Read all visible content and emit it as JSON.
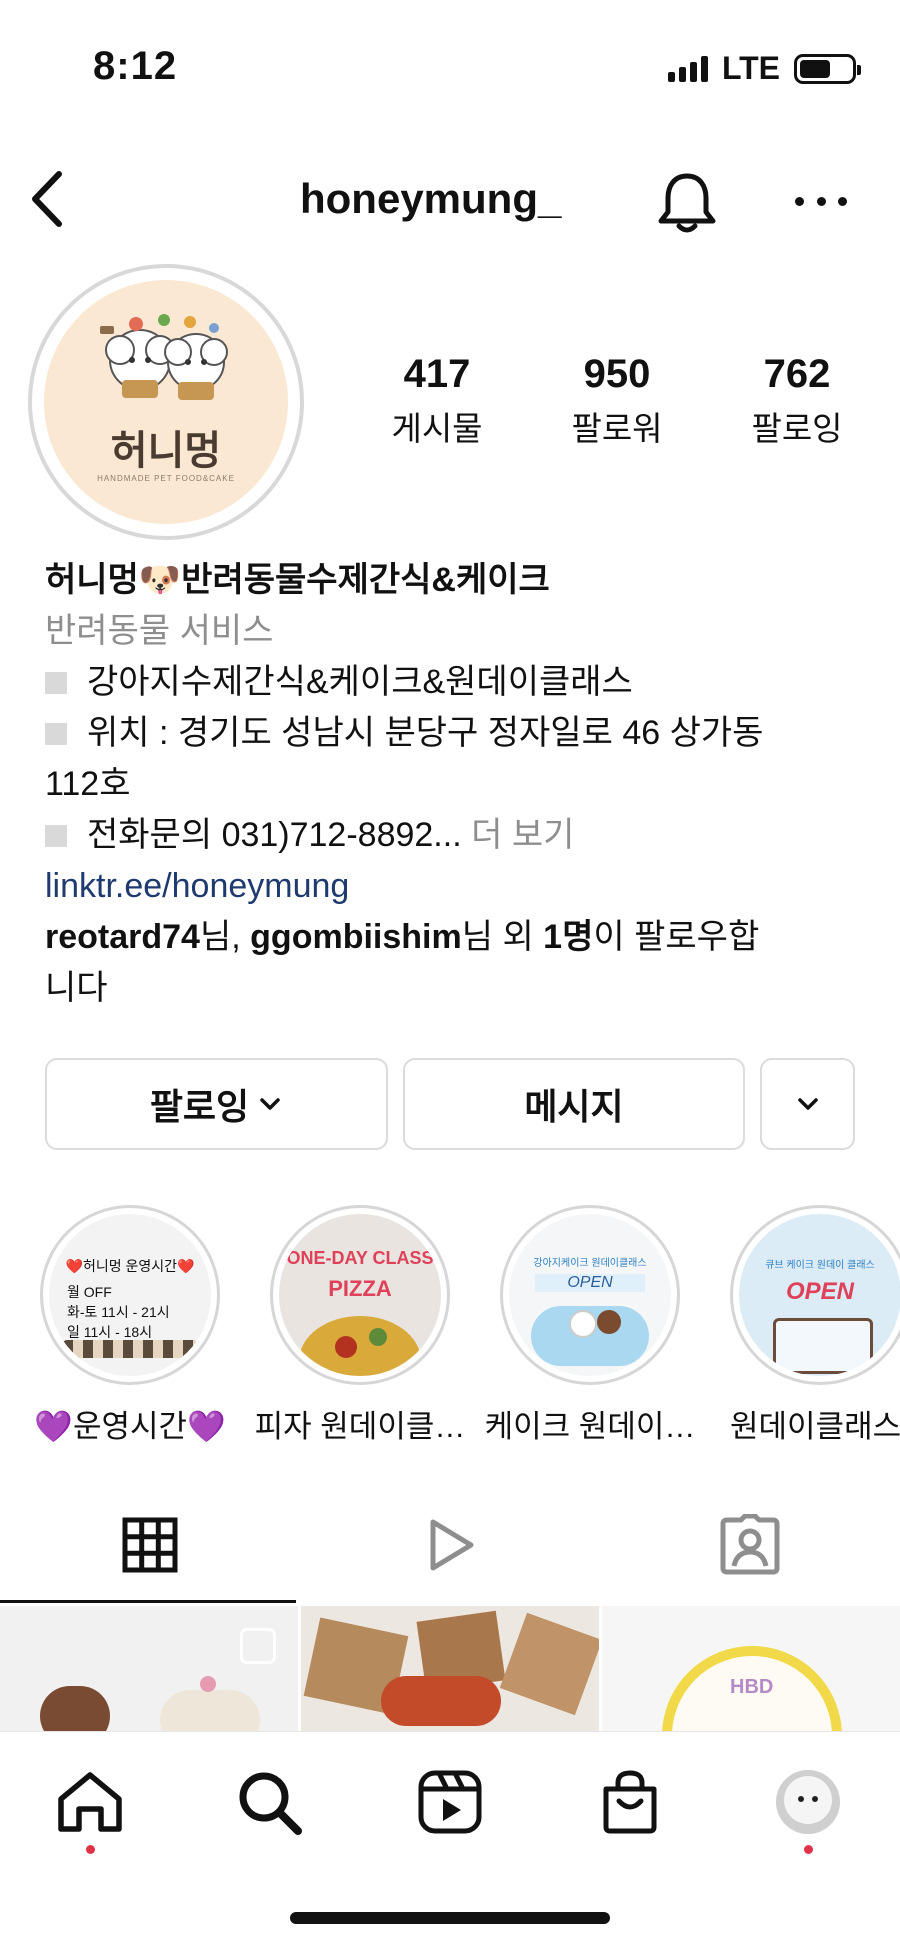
{
  "status_bar": {
    "time": "8:12",
    "network": "LTE"
  },
  "header": {
    "username": "honeymung_"
  },
  "avatar": {
    "logo_text": "허니멍",
    "logo_subtext": "HANDMADE PET FOOD&CAKE"
  },
  "stats": [
    {
      "value": "417",
      "label": "게시물"
    },
    {
      "value": "950",
      "label": "팔로워"
    },
    {
      "value": "762",
      "label": "팔로잉"
    }
  ],
  "bio": {
    "name": "허니멍🐶반려동물수제간식&케이크",
    "category": "반려동물 서비스",
    "line1": "강아지수제간식&케이크&원데이클래스",
    "line2a": "위치 : 경기도 성남시 분당구 정자일로 46 상가동",
    "line2b": "112호",
    "line3": "전화문의 031)712-8892...",
    "more": "더 보기",
    "link": "linktr.ee/honeymung",
    "followed_user1": "reotard74",
    "followed_sep1": "님, ",
    "followed_user2": "ggombiishim",
    "followed_sep2": "님 외 ",
    "followed_count": "1명",
    "followed_suffix_a": "이 팔로우합",
    "followed_suffix_b": "니다"
  },
  "buttons": {
    "following": "팔로잉",
    "message": "메시지"
  },
  "highlights": [
    {
      "label": "💜운영시간💜",
      "card_title": "❤️허니멍 운영시간❤️",
      "rows": [
        "월  OFF",
        "화-토  11시 - 21시",
        "일  11시 - 18시"
      ]
    },
    {
      "label": "피자 원데이클…",
      "card_title": "ONE-DAY CLASS",
      "card_sub": "PIZZA"
    },
    {
      "label": "케이크 원데이…",
      "card_title": "강아지케이크 원데이클래스",
      "card_sub": "OPEN"
    },
    {
      "label": "원데이클래스…",
      "card_title": "큐브 케이크 원데이 클래스",
      "card_sub": "OPEN"
    }
  ],
  "thumbs": {
    "cake_text": "HBD"
  }
}
